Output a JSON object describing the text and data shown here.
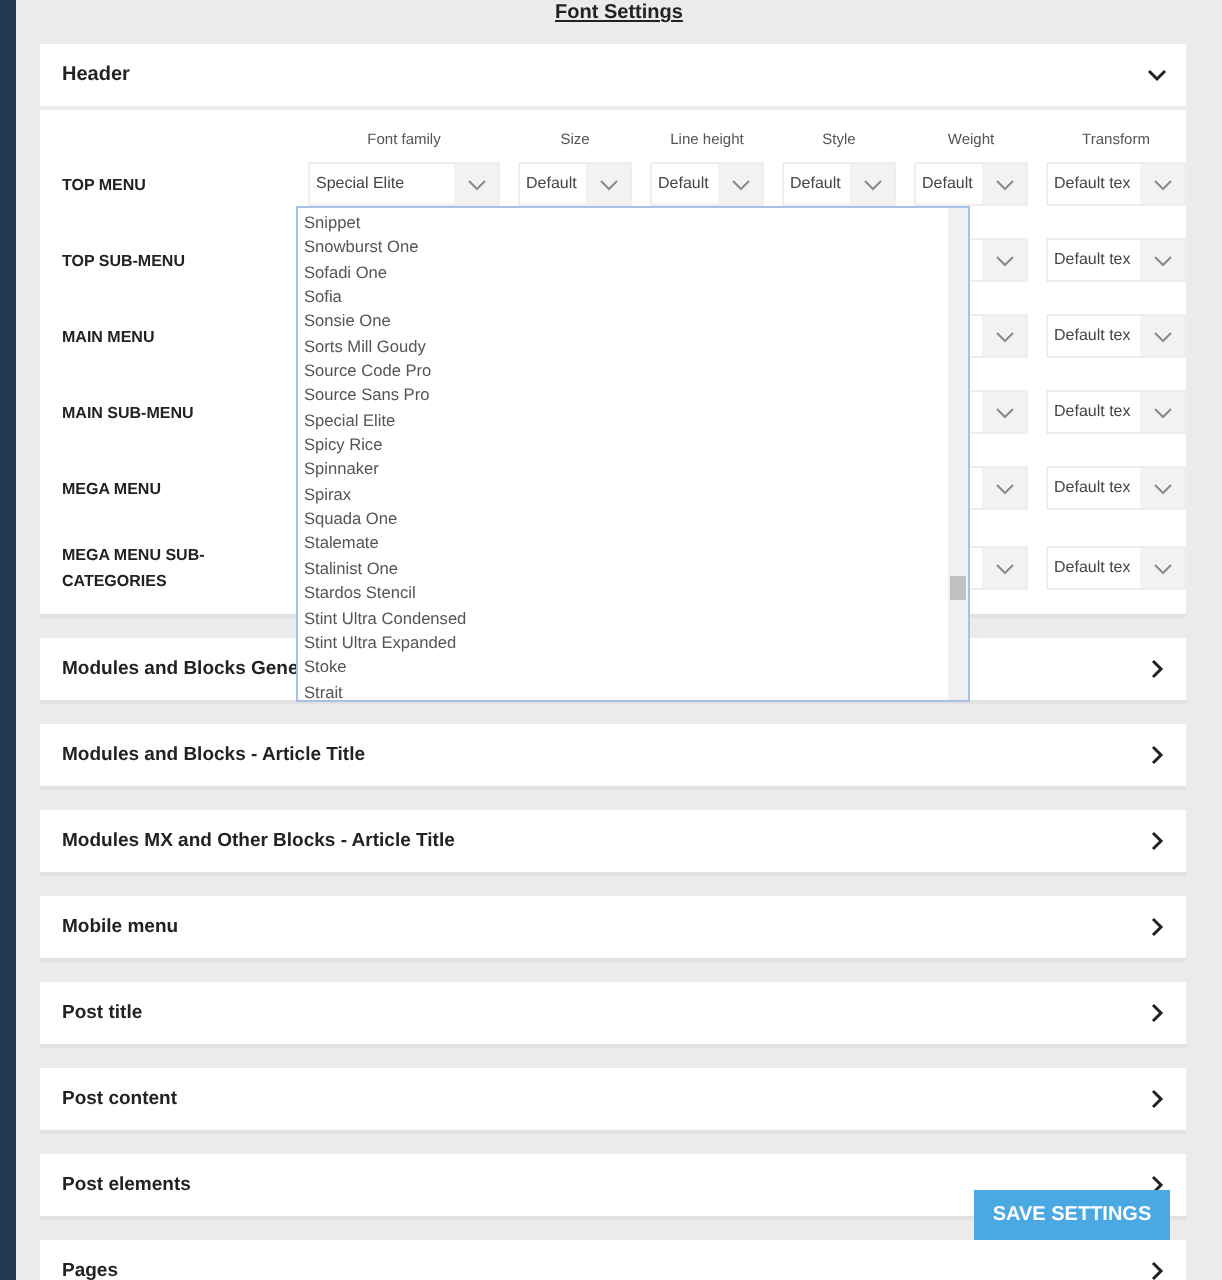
{
  "page_title": "Font Settings",
  "header_panel": {
    "title": "Header",
    "expanded": true,
    "columns": [
      "Font family",
      "Size",
      "Line height",
      "Style",
      "Weight",
      "Transform"
    ],
    "rows": [
      {
        "label": "TOP MENU",
        "values": [
          "Special Elite",
          "Default",
          "Default",
          "Default",
          "Default",
          "Default tex"
        ]
      },
      {
        "label": "TOP SUB-MENU",
        "values": [
          "Default tex"
        ]
      },
      {
        "label": "MAIN MENU",
        "values": [
          "Default tex"
        ]
      },
      {
        "label": "MAIN SUB-MENU",
        "values": [
          "Default tex"
        ]
      },
      {
        "label": "MEGA MENU",
        "values": [
          "Default tex"
        ]
      },
      {
        "label": "MEGA MENU SUB-CATEGORIES",
        "values": [
          "Default tex"
        ]
      }
    ]
  },
  "font_dropdown": {
    "options": [
      "Snippet",
      "Snowburst One",
      "Sofadi One",
      "Sofia",
      "Sonsie One",
      "Sorts Mill Goudy",
      "Source Code Pro",
      "Source Sans Pro",
      "Special Elite",
      "Spicy Rice",
      "Spinnaker",
      "Spirax",
      "Squada One",
      "Stalemate",
      "Stalinist One",
      "Stardos Stencil",
      "Stint Ultra Condensed",
      "Stint Ultra Expanded",
      "Stoke",
      "Strait"
    ]
  },
  "sections": [
    {
      "title": "Modules and Blocks Gene",
      "expanded": false
    },
    {
      "title": "Modules and Blocks - Article Title",
      "expanded": false
    },
    {
      "title": "Modules MX and Other Blocks - Article Title",
      "expanded": false
    },
    {
      "title": "Mobile menu",
      "expanded": false
    },
    {
      "title": "Post title",
      "expanded": false
    },
    {
      "title": "Post content",
      "expanded": false
    },
    {
      "title": "Post elements",
      "expanded": false
    },
    {
      "title": "Pages",
      "expanded": false
    }
  ],
  "save_button": "SAVE SETTINGS"
}
